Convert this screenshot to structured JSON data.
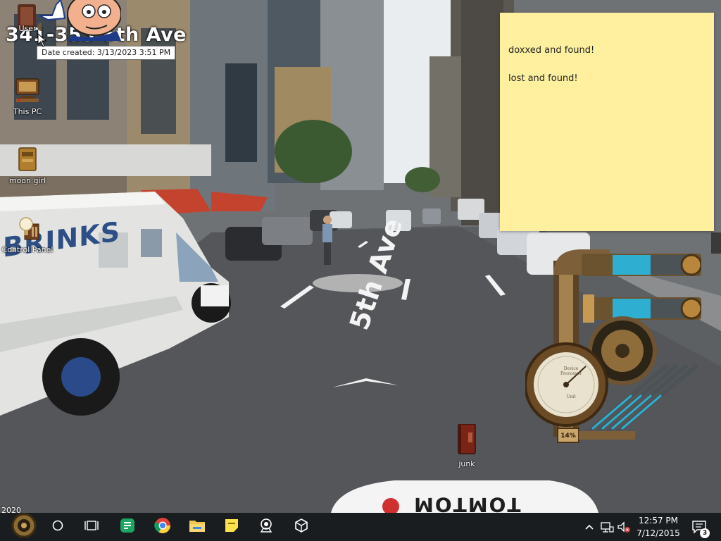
{
  "wallpaper": {
    "street_title": "341-353 5th Ave",
    "road_label": "5th Ave",
    "truck_text": "BRINKS",
    "year_text": "2020",
    "vehicle_brand": "TOMTOM"
  },
  "desktop_icons": [
    {
      "label": "User",
      "icon": "user-folder-icon"
    },
    {
      "label": "This PC",
      "icon": "computer-icon"
    },
    {
      "label": "moon girl",
      "icon": "folder-icon"
    },
    {
      "label": "Control Panel",
      "icon": "control-panel-icon"
    },
    {
      "label": "junk",
      "icon": "book-icon"
    }
  ],
  "tooltip": {
    "text": "Date created: 3/13/2023 3:51 PM"
  },
  "sticky_note": {
    "lines": [
      "doxxed and found!",
      "lost and found!"
    ],
    "color": "#fff0a0"
  },
  "gadget": {
    "percent": "14%",
    "gauge_title": "Device Processor",
    "gauge_unit": "Unit"
  },
  "taskbar": {
    "background": "#1a1d20",
    "pinned": [
      {
        "icon": "start-icon"
      },
      {
        "icon": "search-circle-icon"
      },
      {
        "icon": "task-view-icon"
      },
      {
        "icon": "chat-app-icon"
      },
      {
        "icon": "chrome-icon"
      },
      {
        "icon": "file-explorer-icon"
      },
      {
        "icon": "sticky-notes-icon"
      },
      {
        "icon": "webcam-app-icon"
      },
      {
        "icon": "unity-icon"
      }
    ],
    "clock": {
      "time": "12:57 PM",
      "date": "7/12/2015"
    },
    "notification_count": "3"
  }
}
